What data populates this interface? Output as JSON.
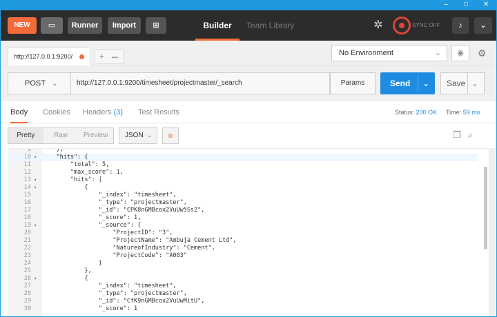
{
  "window": {
    "minimize": "–",
    "maximize": "□",
    "close": "✕"
  },
  "header": {
    "new_label": "NEW",
    "runner_label": "Runner",
    "import_label": "Import",
    "nav_builder": "Builder",
    "nav_team": "Team Library",
    "sync_label": "SYNC OFF"
  },
  "tab": {
    "title": "http://127.0.0.1:9200/",
    "plus": "+",
    "more": "•••"
  },
  "env": {
    "selected": "No Environment"
  },
  "request": {
    "method": "POST",
    "url": "http://127.0.0.1:9200/timesheet/projectmaster/_search",
    "params_label": "Params",
    "send_label": "Send",
    "save_label": "Save"
  },
  "response_tabs": {
    "body": "Body",
    "cookies": "Cookies",
    "headers": "Headers",
    "headers_count": "(3)",
    "tests": "Test Results",
    "status_label": "Status:",
    "status_value": "200 OK",
    "time_label": "Time:",
    "time_value": "59 ms"
  },
  "body_toolbar": {
    "pretty": "Pretty",
    "raw": "Raw",
    "preview": "Preview",
    "format": "JSON"
  },
  "code_lines": [
    {
      "n": "9",
      "fold": "",
      "text": "    },",
      "hl": false
    },
    {
      "n": "10",
      "fold": "▾",
      "text": "    \"hits\": {",
      "hl": true
    },
    {
      "n": "11",
      "fold": "",
      "text": "        \"total\": 5,",
      "hl": false
    },
    {
      "n": "12",
      "fold": "",
      "text": "        \"max_score\": 1,",
      "hl": false
    },
    {
      "n": "13",
      "fold": "▾",
      "text": "        \"hits\": [",
      "hl": false
    },
    {
      "n": "14",
      "fold": "▾",
      "text": "            {",
      "hl": false
    },
    {
      "n": "15",
      "fold": "",
      "text": "                \"_index\": \"timesheet\",",
      "hl": false
    },
    {
      "n": "16",
      "fold": "",
      "text": "                \"_type\": \"projectmaster\",",
      "hl": false
    },
    {
      "n": "17",
      "fold": "",
      "text": "                \"_id\": \"CPK8nGMBcox2VuUw5Ss2\",",
      "hl": false
    },
    {
      "n": "18",
      "fold": "",
      "text": "                \"_score\": 1,",
      "hl": false
    },
    {
      "n": "19",
      "fold": "▾",
      "text": "                \"_source\": {",
      "hl": false
    },
    {
      "n": "20",
      "fold": "",
      "text": "                    \"ProjectID\": \"3\",",
      "hl": false
    },
    {
      "n": "21",
      "fold": "",
      "text": "                    \"ProjectName\": \"Ambuja Cement Ltd\",",
      "hl": false
    },
    {
      "n": "22",
      "fold": "",
      "text": "                    \"NatureofIndustry\": \"Cement\",",
      "hl": false
    },
    {
      "n": "23",
      "fold": "",
      "text": "                    \"ProjectCode\": \"A003\"",
      "hl": false
    },
    {
      "n": "24",
      "fold": "",
      "text": "                }",
      "hl": false
    },
    {
      "n": "25",
      "fold": "",
      "text": "            },",
      "hl": false
    },
    {
      "n": "26",
      "fold": "▾",
      "text": "            {",
      "hl": false
    },
    {
      "n": "27",
      "fold": "",
      "text": "                \"_index\": \"timesheet\",",
      "hl": false
    },
    {
      "n": "28",
      "fold": "",
      "text": "                \"_type\": \"projectmaster\",",
      "hl": false
    },
    {
      "n": "29",
      "fold": "",
      "text": "                \"_id\": \"CfK9nGMBcox2VuUwMitU\",",
      "hl": false
    },
    {
      "n": "30",
      "fold": "",
      "text": "                \"_score\": 1",
      "hl": false
    }
  ]
}
